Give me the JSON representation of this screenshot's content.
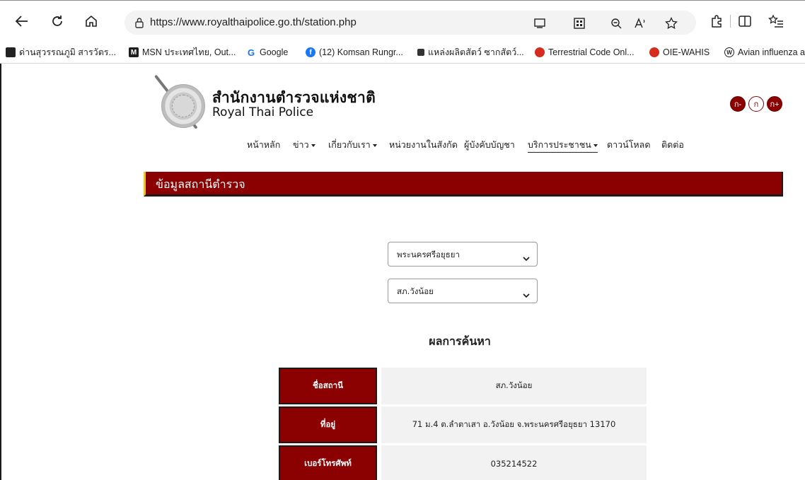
{
  "browser": {
    "url": "https://www.royalthaipolice.go.th/station.php",
    "bookmarks": [
      {
        "label": "ด่านสุวรรณภูมิ สารวัตร...",
        "icon": "bookmark-square-icon"
      },
      {
        "label": "MSN ประเทศไทย, Out...",
        "icon": "msn-icon"
      },
      {
        "label": "Google",
        "icon": "google-icon"
      },
      {
        "label": "(12) Komsan Rungr...",
        "icon": "facebook-icon"
      },
      {
        "label": "แหล่งผลิตสัตว์ ซากสัตว์...",
        "icon": "site-icon"
      },
      {
        "label": "Terrestrial Code Onl...",
        "icon": "woah-icon"
      },
      {
        "label": "OIE-WAHIS",
        "icon": "woah-icon"
      },
      {
        "label": "Avian influenza a",
        "icon": "who-icon"
      }
    ]
  },
  "site": {
    "title_th": "สำนักงานตำรวจแห่งชาติ",
    "title_en": "Royal Thai Police",
    "font_controls": [
      "ก-",
      "ก",
      "ก+"
    ]
  },
  "nav": {
    "items": [
      "หน้าหลัก",
      "ข่าว",
      "เกี่ยวกับเรา",
      "หน่วยงานในสังกัด",
      "ผู้บังคับบัญชา",
      "บริการประชาชน",
      "ดาวน์โหลด",
      "ติดต่อ"
    ]
  },
  "section": {
    "title": "ข้อมูลสถานีตำรวจ"
  },
  "filters": {
    "province": "พระนครศรีอยุธยา",
    "station": "สภ.วังน้อย"
  },
  "results": {
    "title": "ผลการค้นหา",
    "rows": [
      {
        "label": "ชื่อสถานี",
        "value": "สภ.วังน้อย"
      },
      {
        "label": "ที่อยู่",
        "value": "71 ม.4 ต.ลำตาเสา อ.วังน้อย จ.พระนครศรีอยุธยา 13170"
      },
      {
        "label": "เบอร์โทรศัพท์",
        "value": "035214522"
      }
    ]
  },
  "colors": {
    "brand_red": "#8b0000",
    "accent_yellow": "#f0c419"
  }
}
